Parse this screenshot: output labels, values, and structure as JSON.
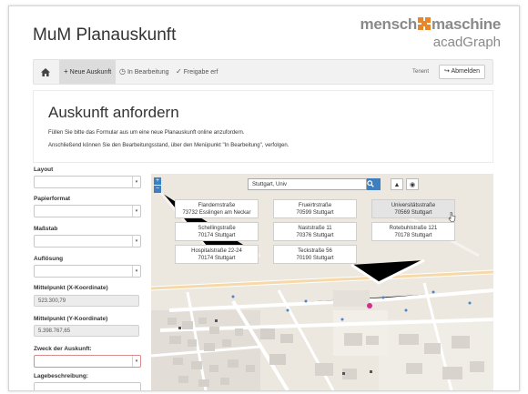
{
  "app": {
    "title": "MuM Planauskunft"
  },
  "brand": {
    "main_left": "mensch",
    "main_right": "maschine",
    "sub": "acadGraph",
    "accent": "#e8862b"
  },
  "nav": {
    "home_icon": "home-icon",
    "items": [
      {
        "icon": "+",
        "label": "Neue Auskunft"
      },
      {
        "icon": "◷",
        "label": "In Bearbeitung"
      },
      {
        "icon": "✓",
        "label": "Freigabe erf"
      }
    ],
    "user": "Tenent",
    "logout_icon": "↪",
    "logout_label": "Abmelden"
  },
  "intro": {
    "title": "Auskunft anfordern",
    "p1": "Füllen Sie bitte das Formular aus um eine neue Planauskunft online anzufordern.",
    "p2": "Anschließend können Sie den Bearbeitungsstand, über den Menüpunkt \"In Bearbeitung\", verfolgen."
  },
  "form": {
    "layout_label": "Layout",
    "papierformat_label": "Papierformat",
    "massstab_label": "Maßstab",
    "aufloesung_label": "Auflösung",
    "x_label": "Mittelpunkt (X-Koordinate)",
    "x_value": "523.300,79",
    "y_label": "Mittelpunkt (Y-Koordinate)",
    "y_value": "5.398.767,65",
    "zweck_label": "Zweck der Auskunft:",
    "lage_label": "Lagebeschreibung:",
    "caret": "▾"
  },
  "map": {
    "search_value": "Stuttgart, Univ",
    "search_icon": "🔍",
    "zoom_in": "+",
    "zoom_out": "−",
    "up_icon": "▲",
    "locate_icon": "◉",
    "suggestions": [
      {
        "street": "Flandernstraße",
        "city": "73732 Esslingen am Neckar"
      },
      {
        "street": "Frueirtrstraße",
        "city": "70599 Stuttgart"
      },
      {
        "street": "Universitätsstraße",
        "city": "70569 Stuttgart"
      },
      {
        "street": "Schellingstraße",
        "city": "70174 Stuttgart"
      },
      {
        "street": "Naststraße 11",
        "city": "70376 Stuttgart"
      },
      {
        "street": "Rotebuhlstraße 121",
        "city": "70178 Stuttgart"
      },
      {
        "street": "Hospitalstraße 22-24",
        "city": "70174 Stuttgart"
      },
      {
        "street": "Teckstraße 56",
        "city": "70190 Stuttgart"
      }
    ]
  }
}
